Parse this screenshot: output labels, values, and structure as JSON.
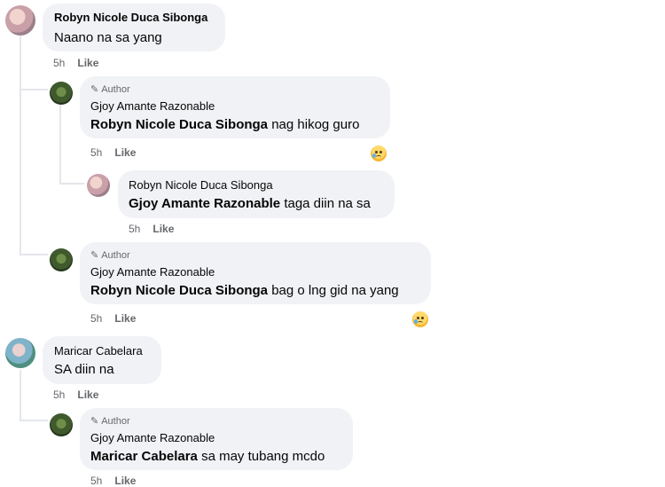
{
  "comments": [
    {
      "name": "Robyn Nicole Duca Sibonga",
      "text": "Naano na sa yang",
      "time": "5h",
      "like": "Like"
    },
    {
      "badge": "Author",
      "name": "Gjoy Amante Razonable",
      "mention": "Robyn Nicole Duca Sibonga",
      "text": " nag hikog guro",
      "time": "5h",
      "like": "Like",
      "reaction": "sad-reaction-icon"
    },
    {
      "name": "Robyn Nicole Duca Sibonga",
      "mention": "Gjoy Amante Razonable",
      "text": " taga diin na sa",
      "time": "5h",
      "like": "Like"
    },
    {
      "badge": "Author",
      "name": "Gjoy Amante Razonable",
      "mention": "Robyn Nicole Duca Sibonga",
      "text": " bag o lng gid na yang",
      "time": "5h",
      "like": "Like",
      "reaction": "sad-reaction-icon"
    },
    {
      "name": "Maricar Cabelara",
      "text": "SA diin na",
      "time": "5h",
      "like": "Like"
    },
    {
      "badge": "Author",
      "name": "Gjoy Amante Razonable",
      "mention": "Maricar Cabelara",
      "text": " sa may tubang mcdo",
      "time": "5h",
      "like": "Like"
    }
  ],
  "colors": {
    "bubble": "#f0f2f5",
    "meta": "#65676b",
    "thread_line": "#e4e6eb"
  }
}
